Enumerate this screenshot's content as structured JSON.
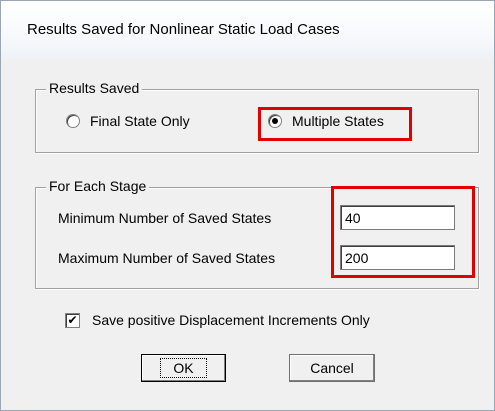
{
  "window": {
    "title": "Results Saved for Nonlinear Static Load Cases"
  },
  "results_saved": {
    "group_label": "Results Saved",
    "options": [
      {
        "label": "Final State Only",
        "selected": false
      },
      {
        "label": "Multiple States",
        "selected": true
      }
    ]
  },
  "each_stage": {
    "group_label": "For Each Stage",
    "min_label": "Minimum Number of Saved States",
    "min_value": "40",
    "max_label": "Maximum Number of Saved States",
    "max_value": "200"
  },
  "options": {
    "positive_increments_label": "Save positive Displacement Increments Only",
    "positive_increments_checked": true,
    "check_glyph": "✔"
  },
  "buttons": {
    "ok_label": "OK",
    "cancel_label": "Cancel"
  },
  "colors": {
    "highlight": "#e00000",
    "dialog_bg": "#f0f0f0"
  }
}
